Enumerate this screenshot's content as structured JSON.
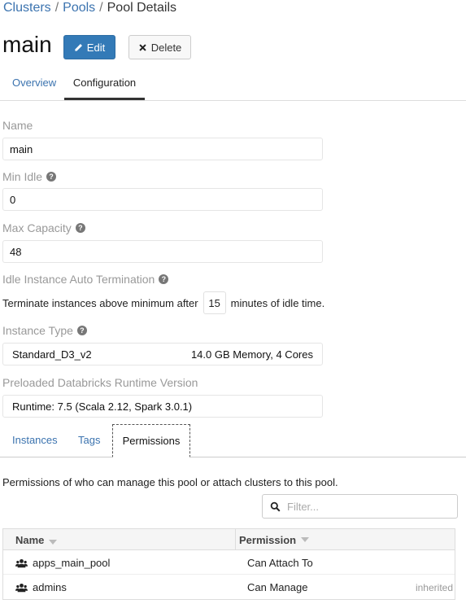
{
  "breadcrumb": {
    "clusters": "Clusters",
    "sep1": "/",
    "pools": "Pools",
    "sep2": "/",
    "current": "Pool Details"
  },
  "header": {
    "title": "main",
    "edit_label": "Edit",
    "delete_label": "Delete"
  },
  "tabs": {
    "overview": "Overview",
    "configuration": "Configuration"
  },
  "form": {
    "name_label": "Name",
    "name_value": "main",
    "min_idle_label": "Min Idle",
    "min_idle_value": "0",
    "max_capacity_label": "Max Capacity",
    "max_capacity_value": "48",
    "auto_term_label": "Idle Instance Auto Termination",
    "auto_term_prefix": "Terminate instances above minimum after",
    "auto_term_value": "15",
    "auto_term_suffix": "minutes of idle time.",
    "instance_type_label": "Instance Type",
    "instance_type_value": "Standard_D3_v2",
    "instance_type_detail": "14.0 GB Memory, 4 Cores",
    "runtime_label": "Preloaded Databricks Runtime Version",
    "runtime_value": "Runtime: 7.5 (Scala 2.12, Spark 3.0.1)"
  },
  "subtabs": {
    "instances": "Instances",
    "tags": "Tags",
    "permissions": "Permissions"
  },
  "permissions": {
    "description": "Permissions of who can manage this pool or attach clusters to this pool.",
    "filter_placeholder": "Filter...",
    "columns": {
      "name": "Name",
      "permission": "Permission"
    },
    "rows": [
      {
        "name": "apps_main_pool",
        "permission": "Can Attach To",
        "note": ""
      },
      {
        "name": "admins",
        "permission": "Can Manage",
        "note": "inherited"
      }
    ]
  },
  "colors": {
    "accent": "#337ab7",
    "link": "#3b73af",
    "label_gray": "#999999"
  },
  "icons": {
    "edit": "pencil-icon",
    "delete": "x-icon",
    "help": "question-circle-icon",
    "search": "search-icon",
    "group": "users-icon",
    "sort": "caret-down-icon"
  }
}
